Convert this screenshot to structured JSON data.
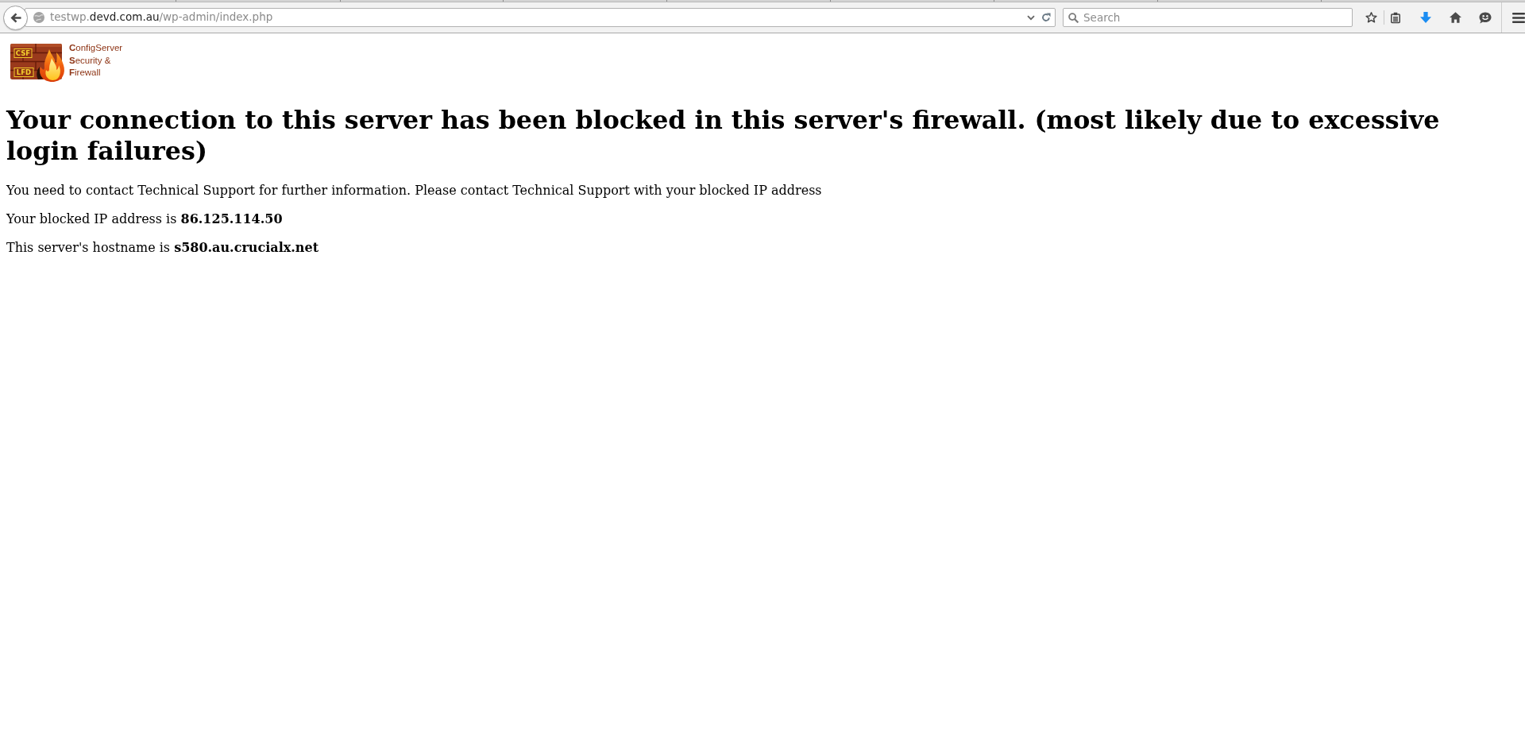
{
  "toolbar": {
    "address": {
      "prefix": "testwp.",
      "domain": "devd.com.au",
      "path": "/wp-admin/index.php"
    },
    "search": {
      "placeholder": "Search"
    }
  },
  "logo": {
    "wall_labels": [
      "CSF",
      "LFD"
    ],
    "lines": [
      "**C**onfigServer",
      "**S**ecurity &",
      "**F**irewall"
    ]
  },
  "heading": "Your connection to this server has been blocked in this server's firewall. (most likely due to excessive login failures)",
  "paragraphs": [
    "You need to contact Technical Support for further information. Please contact Technical Support with your blocked IP address",
    "Your blocked IP address is **86.125.114.50**",
    "This server's hostname is **s580.au.crucialx.net**"
  ]
}
